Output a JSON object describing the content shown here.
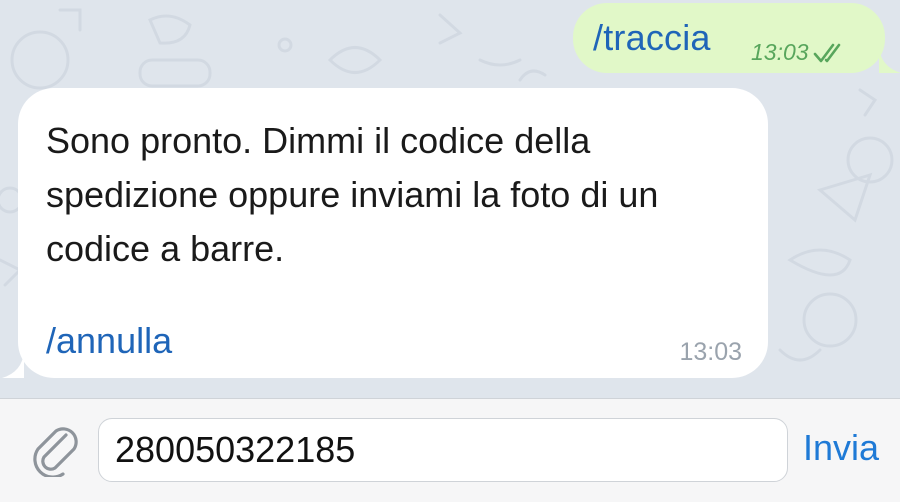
{
  "chat": {
    "messages": [
      {
        "direction": "outgoing",
        "text": "/traccia",
        "time": "13:03",
        "status_icon": "double-check-icon"
      },
      {
        "direction": "incoming",
        "text": "Sono pronto. Dimmi il codice della spedizione oppure inviami la foto di un codice a barre.",
        "command_link": "/annulla",
        "time": "13:03"
      }
    ]
  },
  "composer": {
    "attach_icon": "paperclip-icon",
    "input_value": "280050322185",
    "send_label": "Invia"
  },
  "colors": {
    "chat_background": "#dfe5ec",
    "outgoing_bubble": "#e1f8c8",
    "incoming_bubble": "#ffffff",
    "link": "#1f65b8",
    "send_button": "#1f7ad6",
    "outgoing_time": "#58a65c",
    "incoming_time": "#9aa3ad"
  }
}
